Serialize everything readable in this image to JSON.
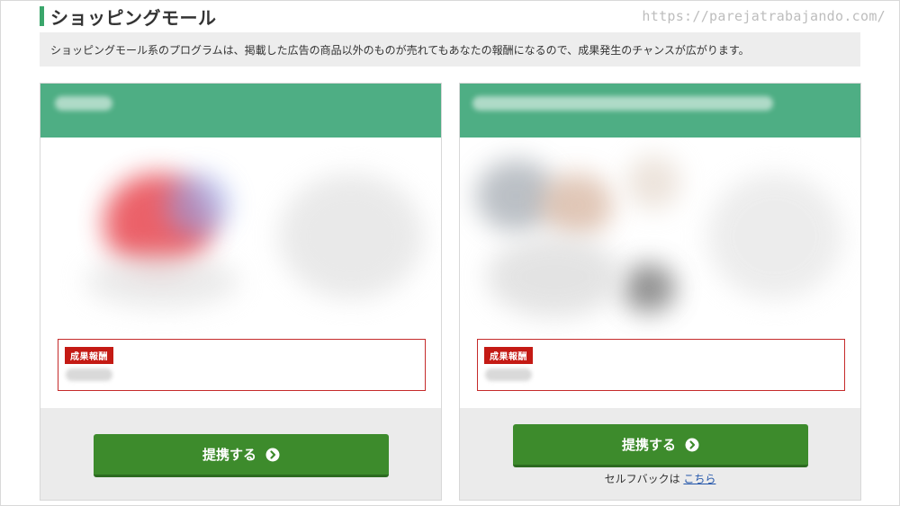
{
  "section": {
    "title": "ショッピングモール",
    "description": "ショッピングモール系のプログラムは、掲載した広告の商品以外のものが売れてもあなたの報酬になるので、成果発生のチャンスが広がります。"
  },
  "watermark": "https://parejatrabajando.com/",
  "colors": {
    "accent_green": "#4eae84",
    "button_green": "#3d8b2c",
    "reward_red": "#c41a14"
  },
  "cards": [
    {
      "reward_label": "成果報酬",
      "button_label": "提携する",
      "button_icon": "chevron-right-circle-icon"
    },
    {
      "reward_label": "成果報酬",
      "button_label": "提携する",
      "button_icon": "chevron-right-circle-icon",
      "selfback_text": "セルフバックは",
      "selfback_link": "こちら"
    }
  ]
}
